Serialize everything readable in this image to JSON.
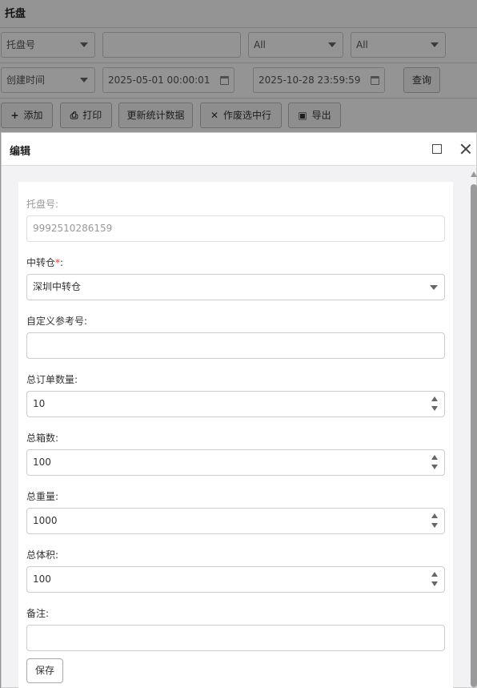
{
  "page": {
    "title": "托盘",
    "filters": {
      "field_select": "托盘号",
      "field_value": "",
      "select_a": "All",
      "select_b": "All",
      "date_type": "创建时间",
      "date_from": "2025-05-01 00:00:01",
      "date_to": "2025-10-28 23:59:59",
      "query_label": "查询"
    },
    "toolbar": {
      "add_label": "添加",
      "print_label": "打印",
      "refresh_stats_label": "更新统计数据",
      "void_label": "作废选中行",
      "export_label": "导出"
    }
  },
  "modal": {
    "title": "编辑",
    "pallet_no_label": "托盘号:",
    "pallet_no_value": "9992510286159",
    "warehouse_label": "中转仓",
    "warehouse_required": "*",
    "warehouse_colon": ":",
    "warehouse_value": "深圳中转仓",
    "custom_ref_label": "自定义参考号:",
    "custom_ref_value": "",
    "total_orders_label": "总订单数量:",
    "total_orders_value": "10",
    "total_boxes_label": "总箱数:",
    "total_boxes_value": "100",
    "total_weight_label": "总重量:",
    "total_weight_value": "1000",
    "total_volume_label": "总体积:",
    "total_volume_value": "100",
    "remark_label": "备注:",
    "remark_value": "",
    "save_label": "保存"
  }
}
